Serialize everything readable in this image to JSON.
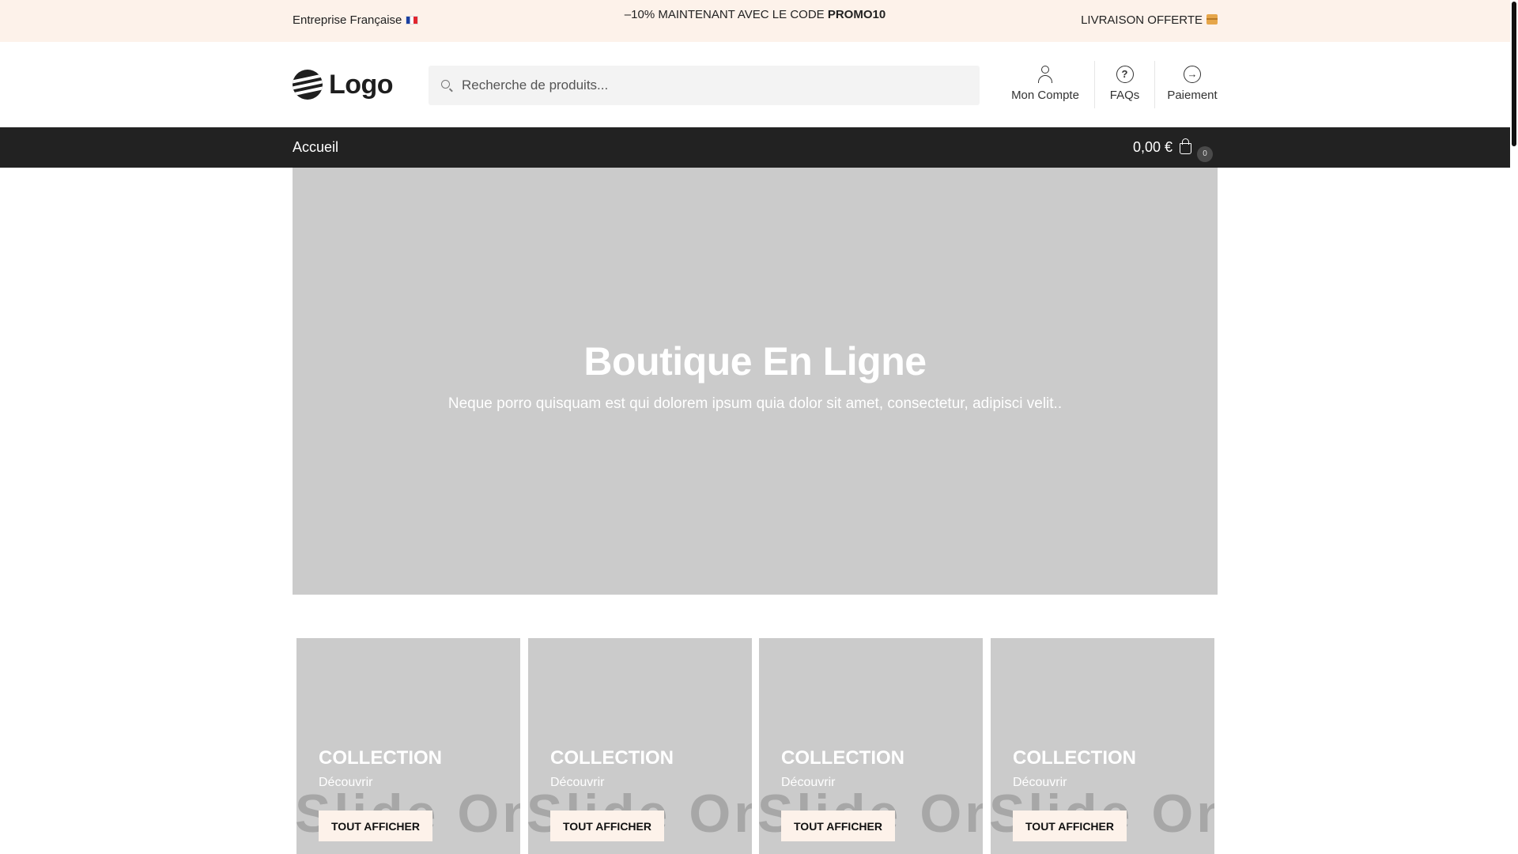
{
  "topbar": {
    "left_text": "Entreprise Française",
    "promo_prefix": "–10% MAINTENANT AVEC LE CODE ",
    "promo_code": "PROMO10",
    "shipping_text": "LIVRAISON OFFERTE"
  },
  "header": {
    "logo_text": "Logo",
    "search": {
      "placeholder": "Recherche de produits..."
    },
    "nav": [
      {
        "label": "Mon Compte",
        "icon": "user-icon"
      },
      {
        "label": "FAQs",
        "icon": "question-circle-icon"
      },
      {
        "label": "Paiement",
        "icon": "arrow-right-circle-icon"
      }
    ]
  },
  "navbar": {
    "home_label": "Accueil",
    "cart_total": "0,00 €",
    "cart_count": "0"
  },
  "hero": {
    "title": "Boutique En Ligne",
    "subtitle": "Neque porro quisquam est qui dolorem ipsum quia dolor sit amet, consectetur, adipisci velit.."
  },
  "collections": [
    {
      "title": "COLLECTION",
      "subtitle": "Découvrir",
      "button": "TOUT AFFICHER",
      "watermark": "Slide One"
    },
    {
      "title": "COLLECTION",
      "subtitle": "Découvrir",
      "button": "TOUT AFFICHER",
      "watermark": "Slide One"
    },
    {
      "title": "COLLECTION",
      "subtitle": "Découvrir",
      "button": "TOUT AFFICHER",
      "watermark": "Slide One"
    },
    {
      "title": "COLLECTION",
      "subtitle": "Découvrir",
      "button": "TOUT AFFICHER",
      "watermark": "Slide One"
    }
  ],
  "colors": {
    "topbar_bg": "#fdf2ea",
    "navbar_bg": "#222222",
    "placeholder_gray": "#cbcbcb"
  }
}
